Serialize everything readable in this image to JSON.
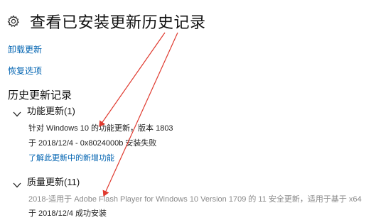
{
  "header": {
    "title": "查看已安装更新历史记录",
    "icon": "gear-icon"
  },
  "links": {
    "uninstall": "卸载更新",
    "recovery": "恢复选项"
  },
  "history": {
    "title": "历史更新记录",
    "groups": [
      {
        "title": "功能更新(1)",
        "entries": [
          {
            "name": "针对 Windows 10 的功能更新，版本 1803",
            "status": "于 2018/12/4 - 0x8024000b 安装失败",
            "link": "了解此更新中的新增功能"
          }
        ]
      },
      {
        "title": "质量更新(11)",
        "entries": [
          {
            "name": "2018-适用于 Adobe Flash Player for Windows 10 Version 1709 的 11 安全更新，适用于基于 x64",
            "status": "于 2018/12/4 成功安装"
          }
        ]
      }
    ]
  },
  "colors": {
    "link": "#0063b1",
    "annotation": "#e03a2f",
    "muted": "#8a8a8a"
  }
}
